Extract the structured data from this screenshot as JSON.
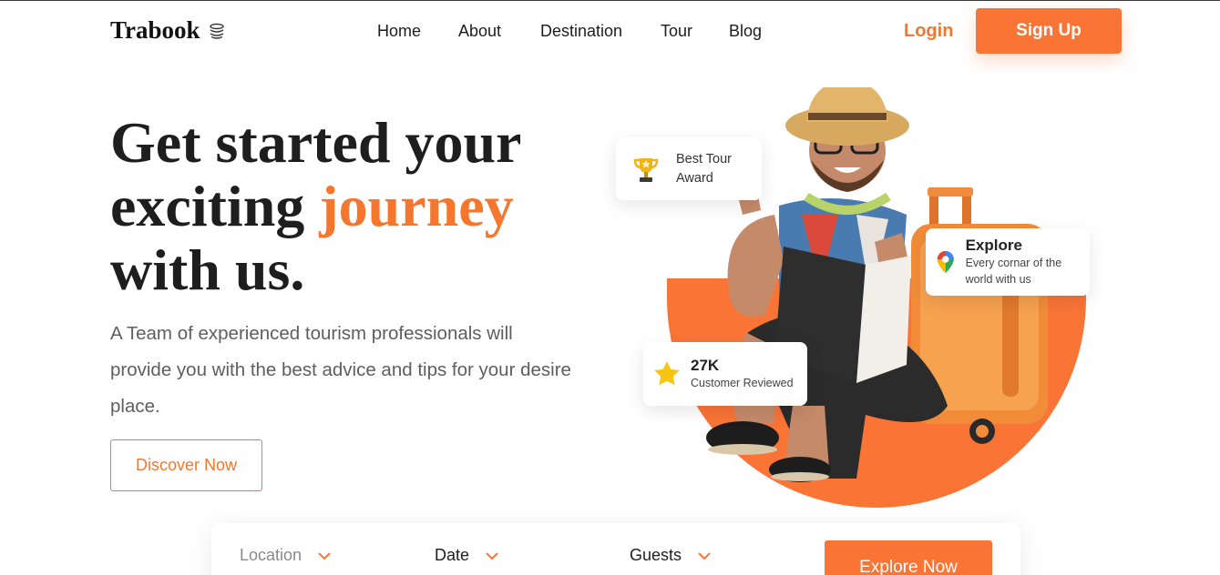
{
  "brand": {
    "name": "Trabook",
    "logo_icon": "stacked-coins-icon"
  },
  "nav": {
    "items": [
      {
        "label": "Home"
      },
      {
        "label": "About"
      },
      {
        "label": "Destination"
      },
      {
        "label": "Tour"
      },
      {
        "label": "Blog"
      }
    ],
    "login_label": "Login",
    "signup_label": "Sign Up"
  },
  "hero": {
    "title_line1": "Get started your",
    "title_line2_prefix": "exciting ",
    "title_line2_accent": "journey",
    "title_line3": "with us.",
    "description": "A Team of experienced tourism professionals will provide you with the best advice and tips for your desire place.",
    "cta_label": "Discover Now"
  },
  "badges": {
    "award": {
      "icon": "trophy-icon",
      "line1": "Best Tour",
      "line2": "Award"
    },
    "explore": {
      "icon": "map-pin-icon",
      "title": "Explore",
      "subtitle": "Every cornar of the world with us"
    },
    "reviews": {
      "icon": "star-icon",
      "count": "27K",
      "label": "Customer Reviewed"
    }
  },
  "search": {
    "location_label": "Location",
    "date_label": "Date",
    "guests_label": "Guests",
    "button_label": "Explore Now"
  },
  "colors": {
    "accent": "#fa7436",
    "accent_text": "#f5772f",
    "heading": "#1e1e1e",
    "body_text": "#5e5e5e"
  }
}
